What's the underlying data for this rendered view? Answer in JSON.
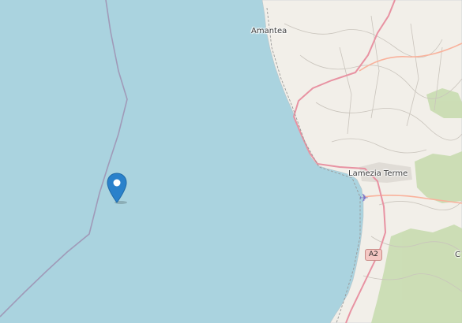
{
  "map": {
    "labels": {
      "amantea": "Amantea",
      "lamezia_terme": "Lamezia Terme",
      "partial_right": "C"
    },
    "road_shield": "A2",
    "airport_icon": "airplane-icon",
    "marker_icon": "map-pin-icon",
    "colors": {
      "sea": "#aad3df",
      "land": "#f2efe9",
      "forest": "#c8dcb0",
      "motorway": "#e892a2",
      "trunk": "#f9b29c",
      "boundary": "#a09ab8",
      "marker": "#2a81cb"
    }
  }
}
